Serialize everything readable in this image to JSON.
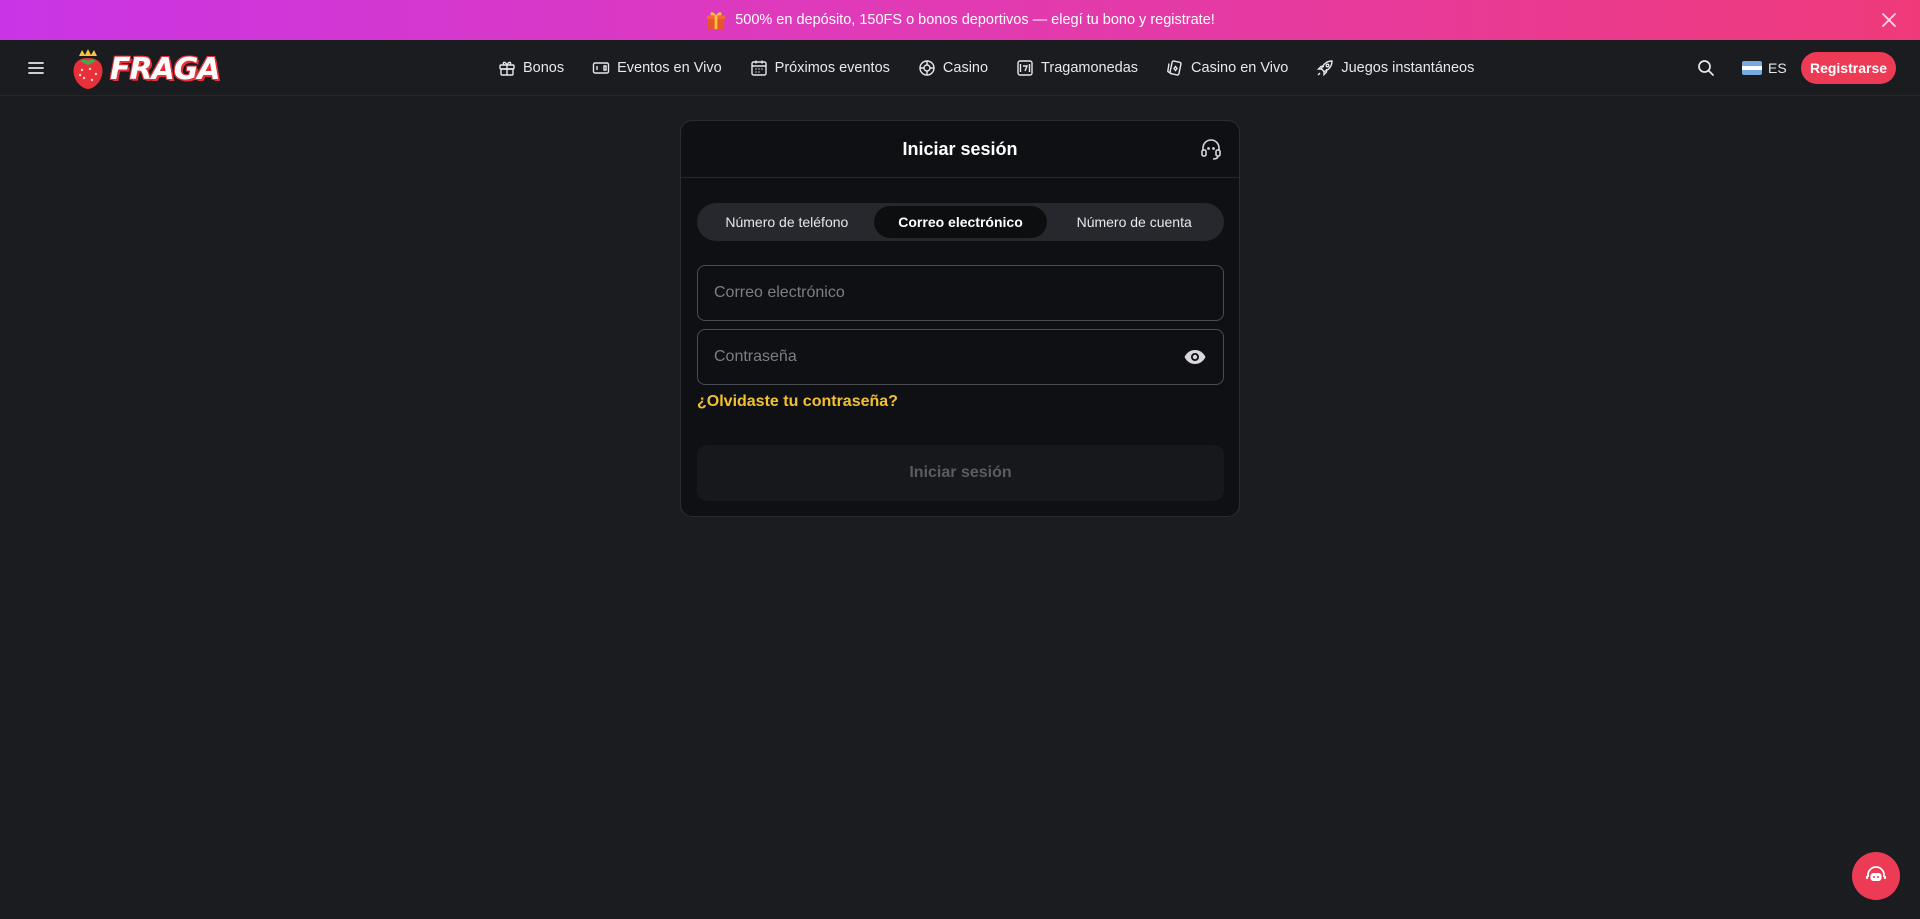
{
  "promo": {
    "text": "500% en depósito, 150FS o bonos deportivos — elegí tu bono y registrate!",
    "icon": "gift-icon",
    "close_icon": "close-icon"
  },
  "header": {
    "logo_text": "FRAGA",
    "nav": [
      {
        "label": "Bonos",
        "icon": "gift-icon"
      },
      {
        "label": "Eventos en Vivo",
        "icon": "scoreboard-icon"
      },
      {
        "label": "Próximos eventos",
        "icon": "calendar-icon"
      },
      {
        "label": "Casino",
        "icon": "roulette-icon"
      },
      {
        "label": "Tragamonedas",
        "icon": "slot-icon"
      },
      {
        "label": "Casino en Vivo",
        "icon": "cards-icon"
      },
      {
        "label": "Juegos instantáneos",
        "icon": "rocket-icon"
      }
    ],
    "language": "ES",
    "register_label": "Registrarse"
  },
  "login": {
    "title": "Iniciar sesión",
    "tabs": [
      {
        "label": "Número de teléfono",
        "active": false
      },
      {
        "label": "Correo electrónico",
        "active": true
      },
      {
        "label": "Número de cuenta",
        "active": false
      }
    ],
    "email": {
      "value": "",
      "placeholder": "Correo electrónico"
    },
    "password": {
      "value": "",
      "placeholder": "Contraseña"
    },
    "forgot_label": "¿Olvidaste tu contraseña?",
    "submit_label": "Iniciar sesión"
  },
  "colors": {
    "background": "#1a1c20",
    "accent": "#ed3a55",
    "link": "#f2c12e"
  }
}
